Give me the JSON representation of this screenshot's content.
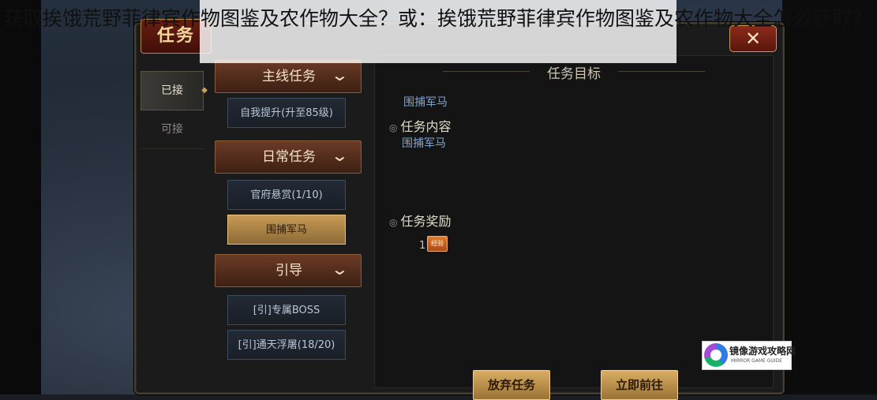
{
  "page_overlay_title": "获取挨饿荒野菲律宾作物图鉴及农作物大全？或：挨饿荒野菲律宾作物图鉴及农作物大全怎么获取？",
  "window": {
    "title": "任务",
    "close_label": "✕"
  },
  "tabs": [
    {
      "label": "已接",
      "active": true
    },
    {
      "label": "可接",
      "active": false
    }
  ],
  "categories": {
    "main": {
      "label": "主线任务",
      "tasks": [
        "自我提升(升至85级)"
      ]
    },
    "daily": {
      "label": "日常任务",
      "tasks": [
        "官府悬赏(1/10)",
        "围捕军马"
      ]
    },
    "guide": {
      "label": "引导",
      "tasks": [
        "[引]专属BOSS",
        "[引]通天浮屠(18/20)"
      ]
    }
  },
  "chevron": "⌄",
  "detail": {
    "heading": "任务目标",
    "objective": "围捕军马",
    "content_title": "任务内容",
    "content": "围捕军马",
    "reward_title": "任务奖励",
    "reward_count": "1",
    "reward_icon_text": "经验"
  },
  "buttons": {
    "abandon": "放弃任务",
    "go": "立即前往"
  },
  "watermark": {
    "name": "镜像游戏攻略网",
    "sub": "MIRROR GAME GUIDE"
  }
}
